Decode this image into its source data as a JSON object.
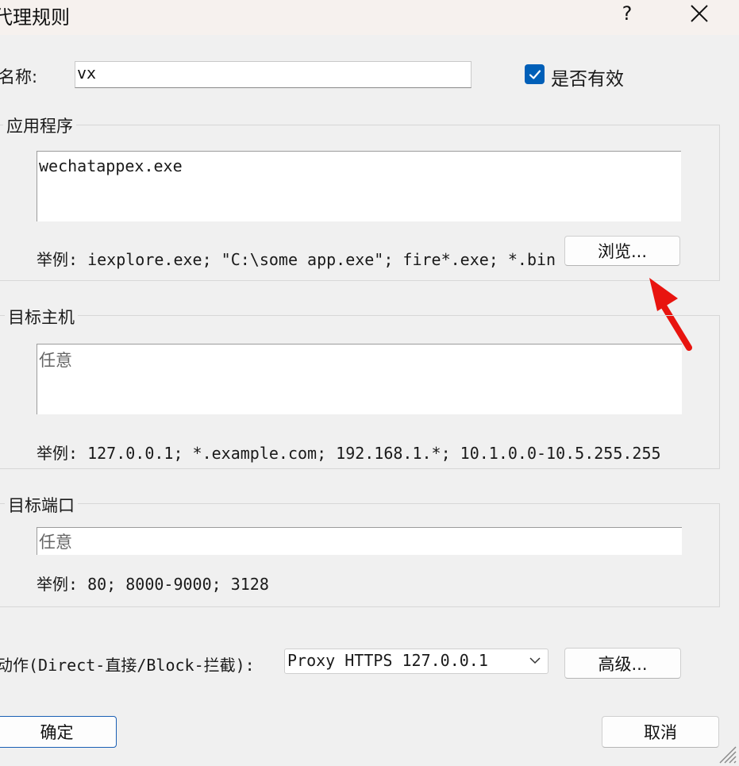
{
  "window": {
    "title": "代理规则",
    "help_glyph": "?"
  },
  "name_row": {
    "label": "名称:",
    "value": "vx",
    "enabled_label": "是否有效",
    "enabled_checked": true
  },
  "applications": {
    "title": "应用程序",
    "value": "wechatappex.exe",
    "example": "举例: iexplore.exe; \"C:\\some app.exe\"; fire*.exe; *.bin",
    "browse_label": "浏览..."
  },
  "target_hosts": {
    "title": "目标主机",
    "value": "任意",
    "example": "举例: 127.0.0.1; *.example.com; 192.168.1.*; 10.1.0.0-10.5.255.255"
  },
  "target_ports": {
    "title": "目标端口",
    "value": "任意",
    "example": "举例: 80; 8000-9000; 3128"
  },
  "action_row": {
    "label": "动作(Direct-直接/Block-拦截):",
    "selected": "Proxy HTTPS 127.0.0.1",
    "advanced_label": "高级..."
  },
  "footer": {
    "ok_label": "确定",
    "cancel_label": "取消"
  },
  "colors": {
    "accent": "#005fb8",
    "annotation_arrow": "#e8140f"
  }
}
